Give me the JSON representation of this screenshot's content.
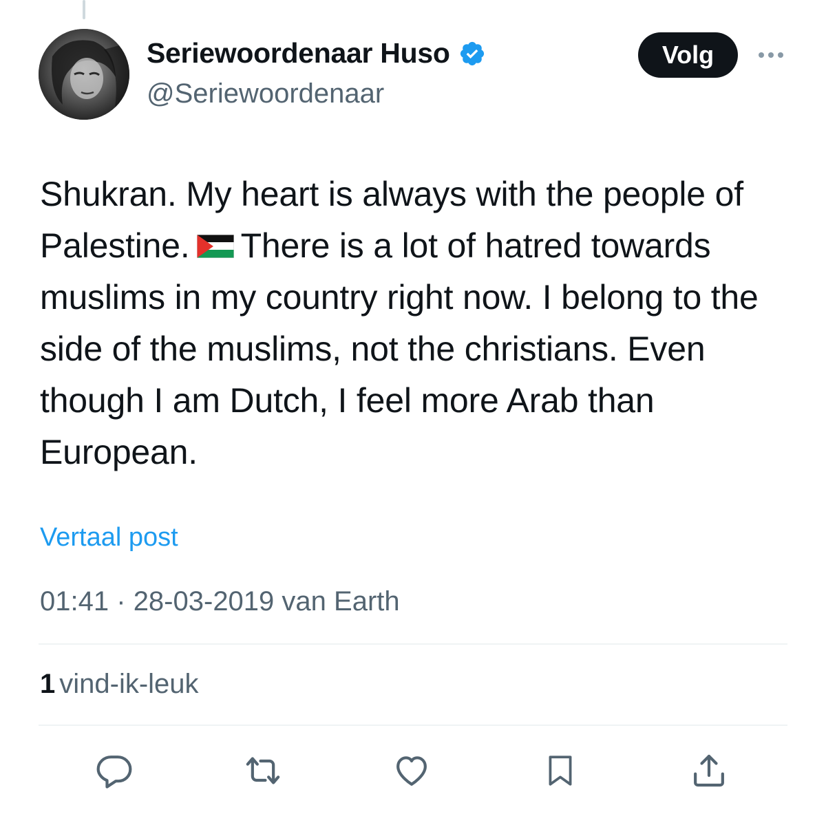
{
  "author": {
    "display_name": "Seriewoordenaar Huso",
    "handle": "@Seriewoordenaar",
    "avatar_icon": "profile-photo-grayscale",
    "verified_icon": "verified-badge-icon",
    "verified_color": "#1d9bf0"
  },
  "follow_button": {
    "label": "Volg"
  },
  "more_icon": "more-horizontal-icon",
  "tweet": {
    "text_lines": [
      "Shukran. My heart is always with the people of",
      "Palestine.",
      "There is a lot of hatred towards",
      "muslims in my country right now. I belong to the",
      "side of the muslims, not the christians. Even",
      "though I am Dutch, I feel more Arab than",
      "European."
    ],
    "emoji": "palestine-flag-emoji"
  },
  "translate_link": "Vertaal post",
  "meta": {
    "time": "01:41",
    "separator": "·",
    "date": "28-03-2019",
    "source": "van Earth"
  },
  "engagement": {
    "likes_count": "1",
    "likes_label": "vind-ik-leuk"
  },
  "actions": [
    {
      "name": "reply",
      "icon": "reply-icon"
    },
    {
      "name": "repost",
      "icon": "repost-icon"
    },
    {
      "name": "like",
      "icon": "heart-icon"
    },
    {
      "name": "bookmark",
      "icon": "bookmark-icon"
    },
    {
      "name": "share",
      "icon": "share-icon"
    }
  ],
  "colors": {
    "text_primary": "#0f1419",
    "text_secondary": "#536471",
    "link": "#1d9bf0",
    "divider": "#eff3f4"
  }
}
